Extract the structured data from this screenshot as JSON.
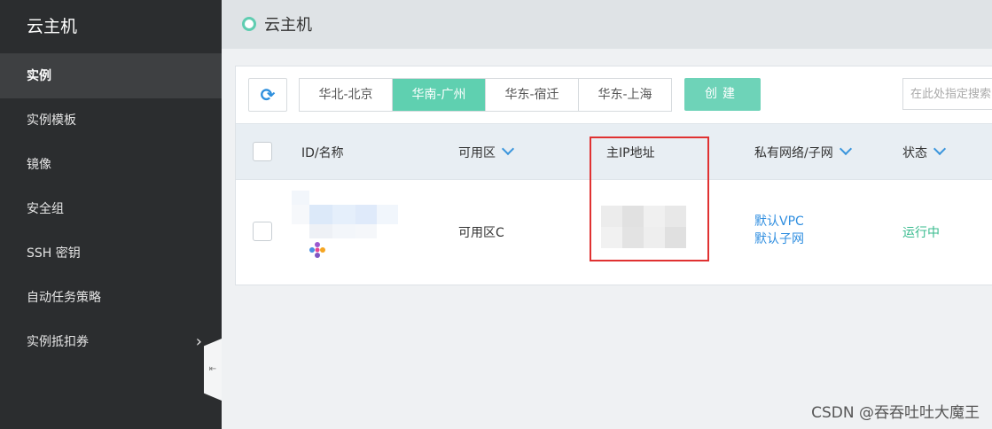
{
  "sidebar": {
    "title": "云主机",
    "items": [
      {
        "label": "实例"
      },
      {
        "label": "实例模板"
      },
      {
        "label": "镜像"
      },
      {
        "label": "安全组"
      },
      {
        "label": "SSH 密钥"
      },
      {
        "label": "自动任务策略"
      },
      {
        "label": "实例抵扣券"
      }
    ],
    "collapse_glyph": "⇤"
  },
  "header": {
    "title": "云主机"
  },
  "toolbar": {
    "refresh_glyph": "⟳",
    "regions": [
      {
        "label": "华北-北京"
      },
      {
        "label": "华南-广州"
      },
      {
        "label": "华东-宿迁"
      },
      {
        "label": "华东-上海"
      }
    ],
    "create_label": "创建",
    "search_placeholder": "在此处指定搜索"
  },
  "table": {
    "columns": [
      "ID/名称",
      "可用区",
      "主IP地址",
      "私有网络/子网",
      "状态"
    ],
    "rows": [
      {
        "zone": "可用区C",
        "vpc": "默认VPC",
        "subnet": "默认子网",
        "status": "运行中"
      }
    ]
  },
  "colors": {
    "accent": "#5fd0b0",
    "link": "#2f8ee0",
    "status_running": "#38bb8e",
    "highlight": "#e03131"
  },
  "watermark": "CSDN @吞吞吐吐大魔王"
}
